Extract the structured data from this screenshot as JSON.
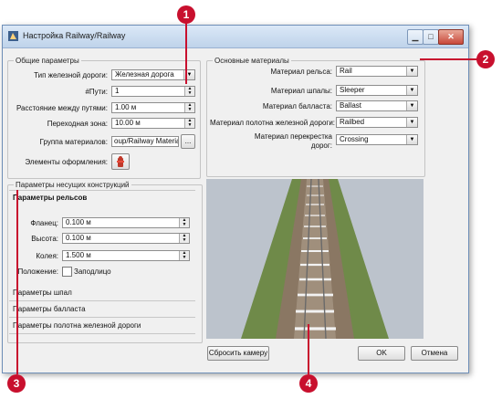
{
  "window": {
    "title": "Настройка Railway/Railway"
  },
  "general": {
    "legend": "Общие параметры",
    "rail_type_label": "Тип железной дороги:",
    "rail_type_value": "Железная дорога",
    "tracks_label": "#Пути:",
    "tracks_value": "1",
    "distance_label": "Расстояние между путями:",
    "distance_value": "1.00 м",
    "transition_label": "Переходная зона:",
    "transition_value": "10.00 м",
    "material_group_label": "Группа материалов:",
    "material_group_value": "oup/Railway Materials",
    "material_group_button": "...",
    "decor_label": "Элементы оформления:"
  },
  "materials": {
    "legend": "Основные материалы",
    "rows": [
      {
        "label": "Материал рельса:",
        "value": "Rail"
      },
      {
        "label": "Материал шпалы:",
        "value": "Sleeper"
      },
      {
        "label": "Материал балласта:",
        "value": "Ballast"
      },
      {
        "label": "Материал полотна железной дороги:",
        "value": "Railbed"
      },
      {
        "label": "Материал перекрестка дорог:",
        "value": "Crossing"
      }
    ]
  },
  "structures": {
    "legend": "Параметры несущих конструкций",
    "active_tab": "Параметры рельсов",
    "flange_label": "Фланец:",
    "flange_value": "0.100 м",
    "height_label": "Высота:",
    "height_value": "0.100 м",
    "gauge_label": "Колея:",
    "gauge_value": "1.500 м",
    "position_label": "Положение:",
    "flush_label": "Заподлицо",
    "tabs": [
      "Параметры шпал",
      "Параметры балласта",
      "Параметры полотна железной дороги"
    ]
  },
  "buttons": {
    "reset_camera": "Сбросить камеру",
    "ok": "OK",
    "cancel": "Отмена"
  },
  "callouts": [
    "1",
    "2",
    "3",
    "4"
  ],
  "colors": {
    "callout": "#c8102e",
    "title_bar": "#c9dbf0",
    "close_button": "#c8483a"
  }
}
